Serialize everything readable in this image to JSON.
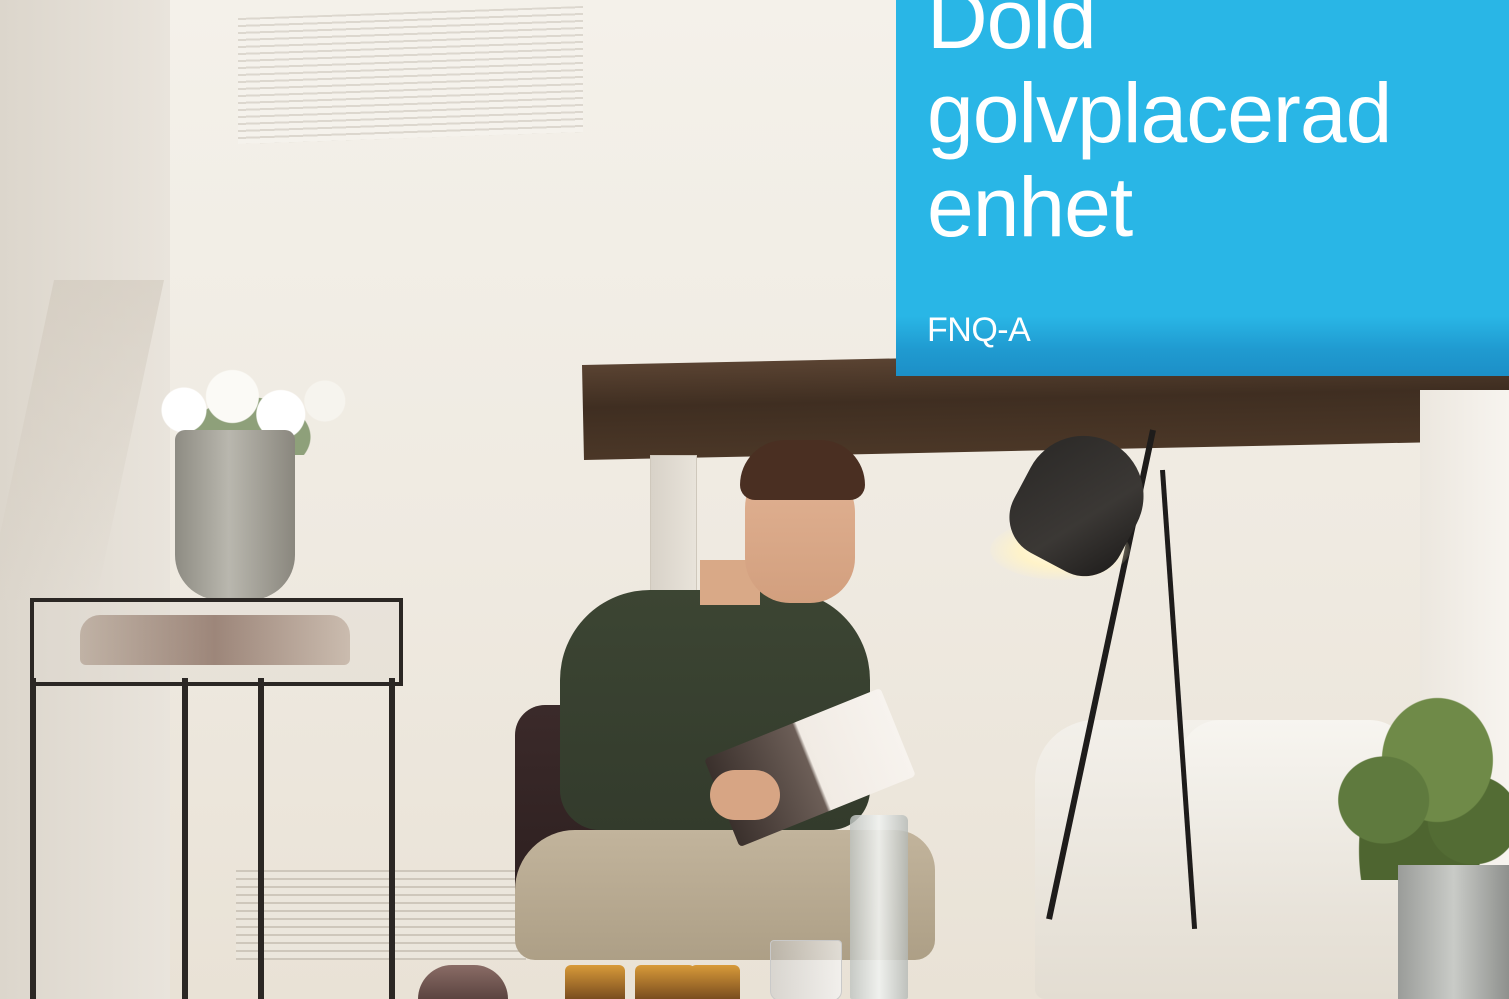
{
  "title": {
    "lines": [
      "Dold",
      "golvplacerad",
      "enhet"
    ]
  },
  "model": "FNQ-A",
  "colors": {
    "accent_box": "#29b6e6",
    "title_text": "#ffffff"
  }
}
